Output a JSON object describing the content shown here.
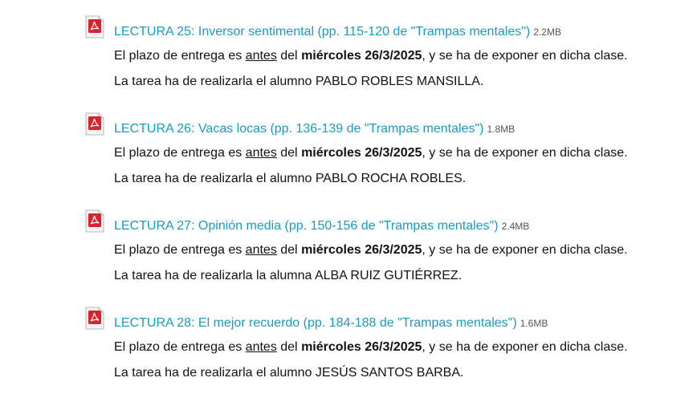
{
  "entries": [
    {
      "title": "LECTURA 25: Inversor sentimental (pp. 115-120 de \"Trampas mentales\")",
      "size": "2.2MB",
      "line1_pre": "El plazo de entrega es ",
      "line1_under": "antes",
      "line1_mid": " del ",
      "line1_bold": "miércoles 26/3/2025",
      "line1_post": ", y se ha de exponer en dicha clase.",
      "line2": "La tarea ha de realizarla el alumno PABLO ROBLES MANSILLA."
    },
    {
      "title": "LECTURA 26: Vacas locas (pp. 136-139 de \"Trampas mentales\")",
      "size": "1.8MB",
      "line1_pre": "El plazo de entrega es ",
      "line1_under": "antes",
      "line1_mid": " del ",
      "line1_bold": "miércoles 26/3/2025",
      "line1_post": ", y se ha de exponer en dicha clase.",
      "line2": "La tarea ha de realizarla el alumno PABLO ROCHA ROBLES."
    },
    {
      "title": "LECTURA 27: Opinión media (pp. 150-156 de \"Trampas mentales\")",
      "size": "2.4MB",
      "line1_pre": "El plazo de entrega es ",
      "line1_under": "antes",
      "line1_mid": " del ",
      "line1_bold": "miércoles 26/3/2025",
      "line1_post": ", y se ha de exponer en dicha clase.",
      "line2": "La tarea ha de realizarla la alumna ALBA RUIZ GUTIÉRREZ."
    },
    {
      "title": "LECTURA 28: El mejor recuerdo (pp. 184-188 de \"Trampas mentales\")",
      "size": "1.6MB",
      "line1_pre": "El plazo de entrega es ",
      "line1_under": "antes",
      "line1_mid": " del ",
      "line1_bold": "miércoles 26/3/2025",
      "line1_post": ", y se ha de exponer en dicha clase.",
      "line2": "La tarea ha de realizarla el alumno JESÚS SANTOS BARBA."
    }
  ],
  "colors": {
    "link": "#1a9bc0",
    "pdf_red": "#d9232d"
  },
  "icon": "pdf-file-icon"
}
